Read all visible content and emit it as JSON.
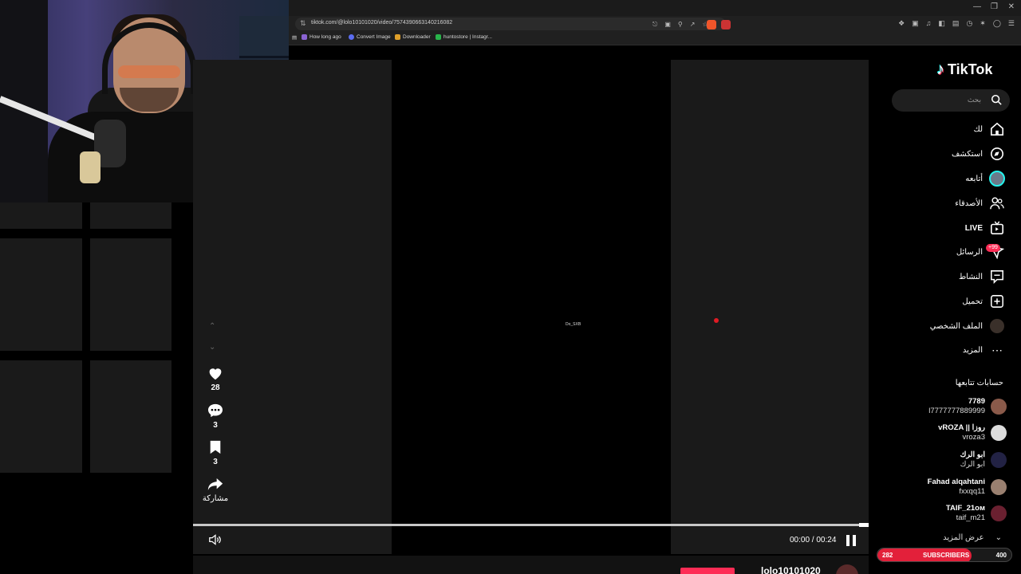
{
  "browser": {
    "url": "tiktok.com/@lolo10101020/video/7574390663140216082",
    "bookmarks": [
      {
        "label": "How long ago",
        "color": "#8a63d2"
      },
      {
        "label": "Convert Image",
        "color": "#5b6cf0"
      },
      {
        "label": "Downloader",
        "color": "#e0a02a"
      },
      {
        "label": "huntostore | Instagr...",
        "color": "#28b44a"
      }
    ]
  },
  "video": {
    "watermark": "Do_SXB",
    "time": "00:00 / 00:24",
    "progress": 1.0
  },
  "actions": {
    "likes": "28",
    "comments": "3",
    "saves": "3",
    "share_label": "مشاركة"
  },
  "author": {
    "username": "lolo10101020"
  },
  "sidebar": {
    "logo": "TikTok",
    "search_placeholder": "بحث",
    "nav": [
      {
        "label": "لك",
        "icon": "home-icon"
      },
      {
        "label": "استكشف",
        "icon": "compass-icon"
      },
      {
        "label": "أتابعه",
        "icon": "following-avatar-icon"
      },
      {
        "label": "الأصدقاء",
        "icon": "friends-icon"
      },
      {
        "label": "LIVE",
        "icon": "live-icon"
      },
      {
        "label": "الرسائل",
        "icon": "messages-icon"
      },
      {
        "label": "النشاط",
        "icon": "activity-icon"
      },
      {
        "label": "تحميل",
        "icon": "upload-icon"
      },
      {
        "label": "الملف الشخصي",
        "icon": "profile-icon"
      },
      {
        "label": "المزيد",
        "icon": "more-icon"
      }
    ],
    "messages_badge": "+99",
    "following_title": "حسابات تتابعها",
    "following": [
      {
        "name": "7789",
        "handle": "l7777777889999",
        "color": "#8a5a4a"
      },
      {
        "name": "vROZA || روزا",
        "handle": "vroza3",
        "color": "#dcdcdc"
      },
      {
        "name": "ابو الرك",
        "handle": "ابو الرك",
        "color": "#222244"
      },
      {
        "name": "Fahad alqahtani",
        "handle": "fxxqq11",
        "color": "#9a8070"
      },
      {
        "name": "TAIF_21ᴏᴍ",
        "handle": "taif_m21",
        "color": "#6a2030"
      }
    ],
    "see_more": "عرض المزيد"
  },
  "subscribers": {
    "current": "282",
    "label": "SUBSCRIBERS",
    "goal": "400",
    "progress": 0.705
  },
  "colors": {
    "accent": "#fe2c55",
    "panel": "#1a1a1a",
    "background": "#000000"
  }
}
